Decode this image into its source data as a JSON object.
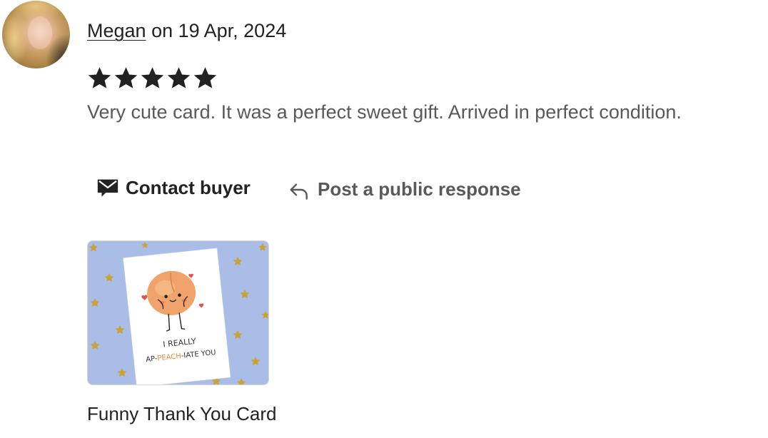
{
  "review": {
    "author": "Megan",
    "date_text": " on 19 Apr, 2024",
    "rating": 5,
    "rating_max": 5,
    "text": "Very cute card. It was a perfect sweet gift. Arrived in perfect condition."
  },
  "actions": {
    "contact_label": "Contact buyer",
    "respond_label": "Post a public response"
  },
  "product": {
    "title": "Funny Thank You Card",
    "card_text_line1": "I REALLY",
    "card_text_line2_pre": "AP-",
    "card_text_line2_mid": "PEACH",
    "card_text_line2_post": "-IATE YOU"
  },
  "icons": {
    "avatar": "user-avatar",
    "star": "star-icon",
    "contact": "envelope-icon",
    "respond": "reply-arrow-icon"
  },
  "colors": {
    "text_primary": "#222222",
    "text_secondary": "#595959",
    "star": "#222222",
    "thumb_background": "#a9bde6",
    "peach": "#f0a36b"
  }
}
